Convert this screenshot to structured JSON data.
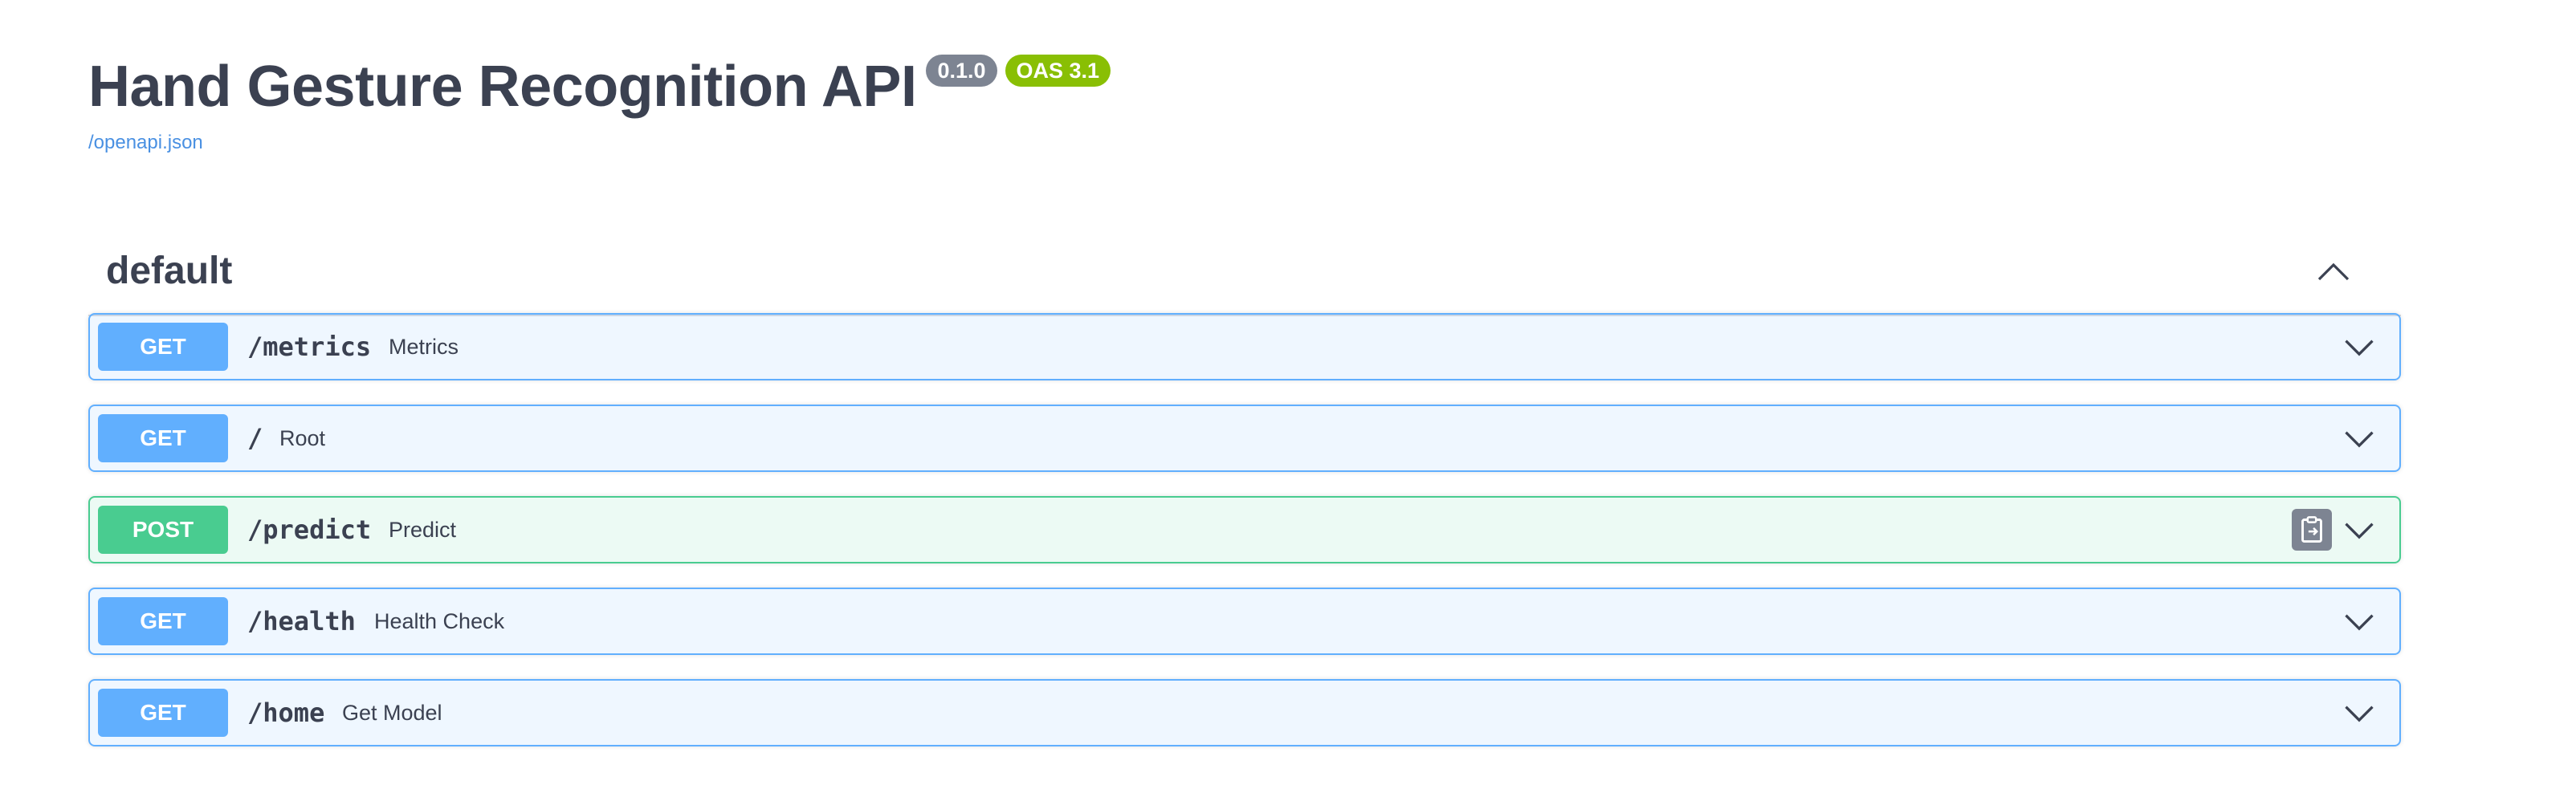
{
  "info": {
    "title": "Hand Gesture Recognition API",
    "version": "0.1.0",
    "oas": "OAS 3.1",
    "spec_link": "/openapi.json"
  },
  "tag": {
    "name": "default",
    "toggle_icon": "chevron-up-icon"
  },
  "operations": [
    {
      "method": "GET",
      "path": "/metrics",
      "summary": "Metrics"
    },
    {
      "method": "GET",
      "path": "/",
      "summary": "Root"
    },
    {
      "method": "POST",
      "path": "/predict",
      "summary": "Predict",
      "has_copy_icon": true
    },
    {
      "method": "GET",
      "path": "/health",
      "summary": "Health Check"
    },
    {
      "method": "GET",
      "path": "/home",
      "summary": "Get Model"
    }
  ],
  "colors": {
    "get": "#61affe",
    "post": "#49cc90",
    "version_badge": "#7d8492",
    "oas_badge": "#89bf04",
    "link": "#4990e2",
    "text": "#3b4151"
  }
}
